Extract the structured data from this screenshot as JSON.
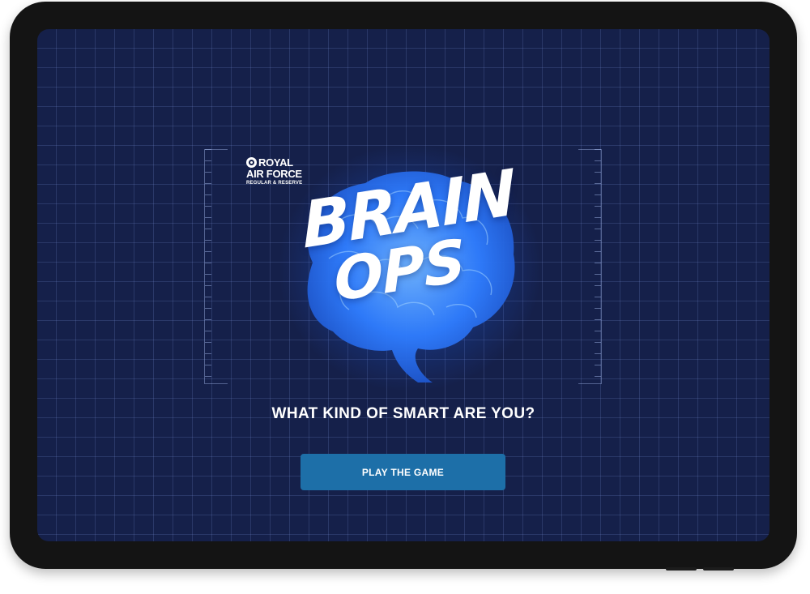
{
  "logo": {
    "line1": "ROYAL",
    "line2": "AIR FORCE",
    "line3": "REGULAR & RESERVE"
  },
  "title": {
    "line1": "BRAIN",
    "line2": "OPS"
  },
  "tagline": "WHAT KIND OF SMART ARE YOU?",
  "play_button": {
    "label": "PLAY THE GAME"
  },
  "colors": {
    "background": "#15204a",
    "grid": "#4a5a8e",
    "button": "#1d6fa8",
    "brain_glow": "#2f7dff",
    "text": "#ffffff"
  },
  "icons": [
    "raf-roundel-icon",
    "brain-illustration"
  ]
}
